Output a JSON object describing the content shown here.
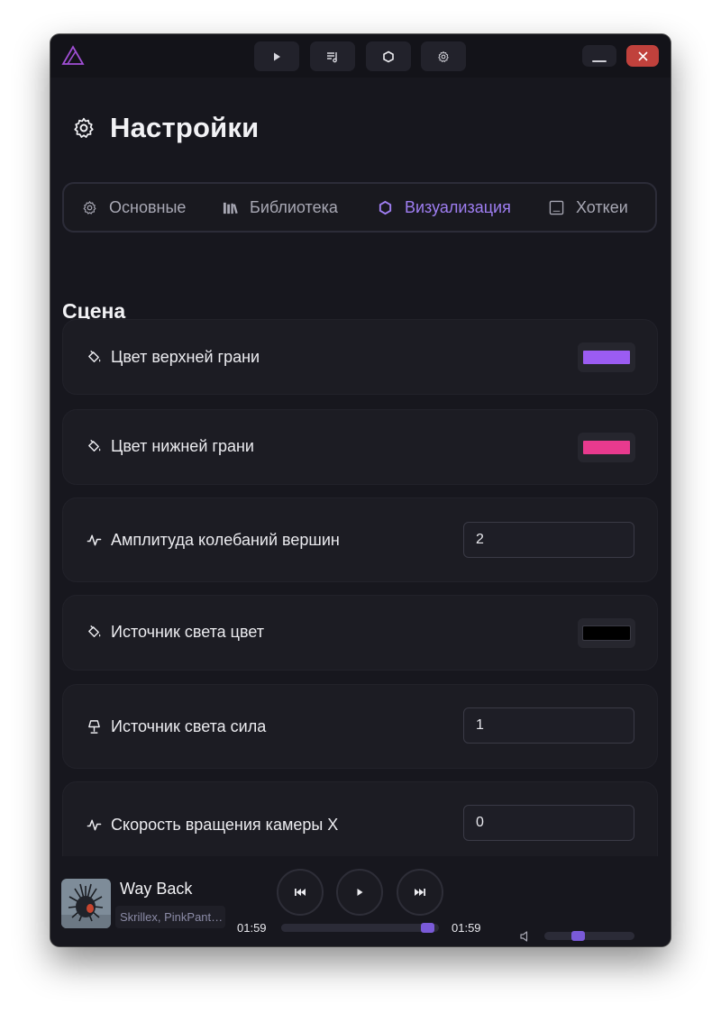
{
  "titlebar": {
    "nav_icons": [
      "play-icon",
      "playlist-icon",
      "hexagon-icon",
      "gear-icon"
    ],
    "minimize_icon": "minimize-icon",
    "close_icon": "close-icon"
  },
  "header": {
    "title": "Настройки",
    "icon": "gear-icon"
  },
  "tabs": [
    {
      "label": "Основные",
      "icon": "gear-icon",
      "active": false
    },
    {
      "label": "Библиотека",
      "icon": "library-icon",
      "active": false
    },
    {
      "label": "Визуализация",
      "icon": "hexagon-icon",
      "active": true
    },
    {
      "label": "Хоткеи",
      "icon": "keyboard-icon",
      "active": false
    }
  ],
  "section": {
    "title": "Сцена"
  },
  "settings": [
    {
      "label": "Цвет верхней грани",
      "icon": "paint-bucket-icon",
      "type": "color",
      "value": "#9b5cf2"
    },
    {
      "label": "Цвет нижней грани",
      "icon": "paint-bucket-icon",
      "type": "color",
      "value": "#e83a8e"
    },
    {
      "label": "Амплитуда колебаний вершин",
      "icon": "wave-icon",
      "type": "number",
      "value": "2"
    },
    {
      "label": "Источник света цвет",
      "icon": "paint-bucket-icon",
      "type": "color",
      "value": "#000000"
    },
    {
      "label": "Источник света сила",
      "icon": "lamp-icon",
      "type": "number",
      "value": "1"
    },
    {
      "label": "Скорость вращения камеры X",
      "icon": "wave-icon",
      "type": "number",
      "value": "0"
    }
  ],
  "player": {
    "track_title": "Way Back",
    "artist": "Skrillex, PinkPant…",
    "time_elapsed": "01:59",
    "time_total": "01:59",
    "progress": 0.97,
    "volume": 0.33,
    "controls": [
      "previous-icon",
      "play-icon",
      "next-icon"
    ]
  },
  "colors": {
    "accent": "#9f7ef2",
    "background": "#17171e",
    "close": "#c0413c"
  }
}
